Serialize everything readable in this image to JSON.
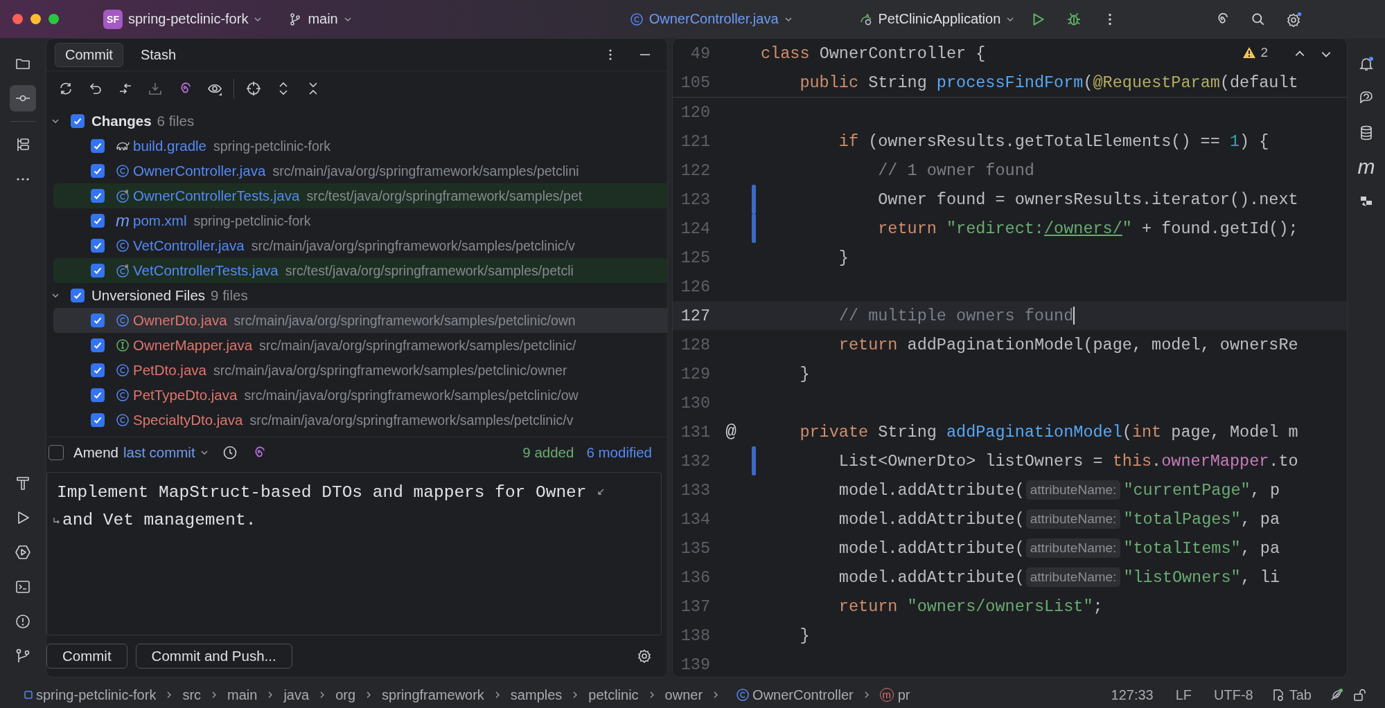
{
  "title_bar": {
    "project_badge": "SF",
    "project": "spring-petclinic-fork",
    "branch": "main",
    "file": "OwnerController.java",
    "run_config": "PetClinicApplication"
  },
  "commit_panel": {
    "tabs": [
      {
        "label": "Commit",
        "selected": true
      },
      {
        "label": "Stash",
        "selected": false
      }
    ],
    "groups": [
      {
        "label": "Changes",
        "count": "6 files",
        "checked": true,
        "expanded": true,
        "bold": true,
        "files": [
          {
            "name": "build.gradle",
            "path": "spring-petclinic-fork",
            "kind": "gradle",
            "color": "#548af7",
            "checked": true,
            "selected": false,
            "highlighted": false
          },
          {
            "name": "OwnerController.java",
            "path": "src/main/java/org/springframework/samples/petclini",
            "kind": "class",
            "color": "#548af7",
            "checked": true,
            "selected": false,
            "highlighted": false
          },
          {
            "name": "OwnerControllerTests.java",
            "path": "src/test/java/org/springframework/samples/pet",
            "kind": "test-class",
            "color": "#548af7",
            "checked": true,
            "selected": false,
            "highlighted": true
          },
          {
            "name": "pom.xml",
            "path": "spring-petclinic-fork",
            "kind": "maven",
            "glyph": "m",
            "color": "#548af7",
            "checked": true,
            "selected": false,
            "highlighted": false
          },
          {
            "name": "VetController.java",
            "path": "src/main/java/org/springframework/samples/petclinic/v",
            "kind": "class",
            "color": "#548af7",
            "checked": true,
            "selected": false,
            "highlighted": false
          },
          {
            "name": "VetControllerTests.java",
            "path": "src/test/java/org/springframework/samples/petcli",
            "kind": "test-class",
            "color": "#548af7",
            "checked": true,
            "selected": false,
            "highlighted": true
          }
        ]
      },
      {
        "label": "Unversioned Files",
        "count": "9 files",
        "checked": true,
        "expanded": true,
        "bold": false,
        "files": [
          {
            "name": "OwnerDto.java",
            "path": "src/main/java/org/springframework/samples/petclinic/own",
            "kind": "class",
            "color": "#e0756e",
            "checked": true,
            "selected": true,
            "highlighted": false
          },
          {
            "name": "OwnerMapper.java",
            "path": "src/main/java/org/springframework/samples/petclinic/",
            "kind": "interface",
            "color": "#e0756e",
            "checked": true,
            "selected": false,
            "highlighted": false
          },
          {
            "name": "PetDto.java",
            "path": "src/main/java/org/springframework/samples/petclinic/owner",
            "kind": "class",
            "color": "#e0756e",
            "checked": true,
            "selected": false,
            "highlighted": false
          },
          {
            "name": "PetTypeDto.java",
            "path": "src/main/java/org/springframework/samples/petclinic/ow",
            "kind": "class",
            "color": "#e0756e",
            "checked": true,
            "selected": false,
            "highlighted": false
          },
          {
            "name": "SpecialtyDto.java",
            "path": "src/main/java/org/springframework/samples/petclinic/v",
            "kind": "class",
            "color": "#e0756e",
            "checked": true,
            "selected": false,
            "highlighted": false
          }
        ]
      }
    ],
    "amend": {
      "checked": false,
      "label": "Amend",
      "link": "last commit"
    },
    "summary": [
      {
        "text": "9 added",
        "color": "#6aab73"
      },
      {
        "text": "6 modified",
        "color": "#548af7"
      }
    ],
    "message_lines": [
      "Implement MapStruct-based DTOs and mappers for Owner",
      "and Vet management."
    ],
    "buttons": [
      "Commit",
      "Commit and Push..."
    ]
  },
  "editor": {
    "warnings": "2",
    "sticky_lines": [
      {
        "number": "49",
        "tokens": [
          {
            "kind": "keyword",
            "text": "class "
          },
          {
            "kind": "plain",
            "text": "OwnerController {"
          }
        ]
      },
      {
        "number": "105",
        "tokens": [
          {
            "kind": "keyword",
            "text": "    public "
          },
          {
            "kind": "plain",
            "text": "String "
          },
          {
            "kind": "method",
            "text": "processFindForm"
          },
          {
            "kind": "plain",
            "text": "("
          },
          {
            "kind": "annotation",
            "text": "@RequestParam"
          },
          {
            "kind": "plain",
            "text": "(default"
          }
        ]
      }
    ],
    "lines": [
      {
        "number": "120",
        "current": false,
        "changed": false
      },
      {
        "number": "121",
        "current": false,
        "changed": false,
        "tokens": [
          {
            "kind": "keyword",
            "text": "        if "
          },
          {
            "kind": "plain",
            "text": "(ownersResults.getTotalElements() == "
          },
          {
            "kind": "number",
            "text": "1"
          },
          {
            "kind": "plain",
            "text": ") {"
          }
        ]
      },
      {
        "number": "122",
        "current": false,
        "changed": false,
        "tokens": [
          {
            "kind": "comment",
            "text": "            // 1 owner found"
          }
        ]
      },
      {
        "number": "123",
        "current": false,
        "changed": true,
        "tokens": [
          {
            "kind": "plain",
            "text": "            Owner found = ownersResults.iterator().next"
          }
        ]
      },
      {
        "number": "124",
        "current": false,
        "changed": true,
        "tokens": [
          {
            "kind": "keyword",
            "text": "            return "
          },
          {
            "kind": "string",
            "text": "\"redirect:"
          },
          {
            "kind": "url",
            "text": "/owners/"
          },
          {
            "kind": "string",
            "text": "\""
          },
          {
            "kind": "plain",
            "text": " + found.getId();"
          }
        ]
      },
      {
        "number": "125",
        "current": false,
        "changed": false,
        "tokens": [
          {
            "kind": "plain",
            "text": "        }"
          }
        ]
      },
      {
        "number": "126",
        "current": false,
        "changed": false
      },
      {
        "number": "127",
        "current": true,
        "changed": false,
        "tokens": [
          {
            "kind": "comment",
            "text": "        // multiple owners found"
          }
        ]
      },
      {
        "number": "128",
        "current": false,
        "changed": false,
        "tokens": [
          {
            "kind": "keyword",
            "text": "        return "
          },
          {
            "kind": "plain",
            "text": "addPaginationModel(page, model, ownersRe"
          }
        ]
      },
      {
        "number": "129",
        "current": false,
        "changed": false,
        "tokens": [
          {
            "kind": "plain",
            "text": "    }"
          }
        ]
      },
      {
        "number": "130",
        "current": false,
        "changed": false
      },
      {
        "number": "131",
        "current": false,
        "changed": false,
        "gutter_mark": "@",
        "tokens": [
          {
            "kind": "keyword",
            "text": "    private "
          },
          {
            "kind": "plain",
            "text": "String "
          },
          {
            "kind": "method",
            "text": "addPaginationModel"
          },
          {
            "kind": "plain",
            "text": "("
          },
          {
            "kind": "keyword",
            "text": "int "
          },
          {
            "kind": "plain",
            "text": "page, Model m"
          }
        ]
      },
      {
        "number": "132",
        "current": false,
        "changed": true,
        "tokens": [
          {
            "kind": "plain",
            "text": "        List<OwnerDto> listOwners = "
          },
          {
            "kind": "keyword",
            "text": "this"
          },
          {
            "kind": "plain",
            "text": "."
          },
          {
            "kind": "field",
            "text": "ownerMapper"
          },
          {
            "kind": "plain",
            "text": ".to"
          }
        ]
      },
      {
        "number": "133",
        "current": false,
        "changed": false,
        "tokens": [
          {
            "kind": "plain",
            "text": "        model.addAttribute("
          },
          {
            "kind": "hint",
            "text": "attributeName:"
          },
          {
            "kind": "string",
            "text": "\"currentPage\""
          },
          {
            "kind": "plain",
            "text": ", p"
          }
        ]
      },
      {
        "number": "134",
        "current": false,
        "changed": false,
        "tokens": [
          {
            "kind": "plain",
            "text": "        model.addAttribute("
          },
          {
            "kind": "hint",
            "text": "attributeName:"
          },
          {
            "kind": "string",
            "text": "\"totalPages\""
          },
          {
            "kind": "plain",
            "text": ", pa"
          }
        ]
      },
      {
        "number": "135",
        "current": false,
        "changed": false,
        "tokens": [
          {
            "kind": "plain",
            "text": "        model.addAttribute("
          },
          {
            "kind": "hint",
            "text": "attributeName:"
          },
          {
            "kind": "string",
            "text": "\"totalItems\""
          },
          {
            "kind": "plain",
            "text": ", pa"
          }
        ]
      },
      {
        "number": "136",
        "current": false,
        "changed": false,
        "tokens": [
          {
            "kind": "plain",
            "text": "        model.addAttribute("
          },
          {
            "kind": "hint",
            "text": "attributeName:"
          },
          {
            "kind": "string",
            "text": "\"listOwners\""
          },
          {
            "kind": "plain",
            "text": ", li"
          }
        ]
      },
      {
        "number": "137",
        "current": false,
        "changed": false,
        "tokens": [
          {
            "kind": "keyword",
            "text": "        return "
          },
          {
            "kind": "string",
            "text": "\"owners/ownersList\""
          },
          {
            "kind": "plain",
            "text": ";"
          }
        ]
      },
      {
        "number": "138",
        "current": false,
        "changed": false,
        "tokens": [
          {
            "kind": "plain",
            "text": "    }"
          }
        ]
      },
      {
        "number": "139",
        "current": false,
        "changed": false
      }
    ]
  },
  "right_strip": {
    "maven_glyph": "m"
  },
  "status_bar": {
    "breadcrumbs": [
      {
        "kind": "project",
        "text": "spring-petclinic-fork"
      },
      {
        "kind": "folder",
        "text": "src"
      },
      {
        "kind": "folder",
        "text": "main"
      },
      {
        "kind": "folder",
        "text": "java"
      },
      {
        "kind": "folder",
        "text": "org"
      },
      {
        "kind": "folder",
        "text": "springframework"
      },
      {
        "kind": "folder",
        "text": "samples"
      },
      {
        "kind": "folder",
        "text": "petclinic"
      },
      {
        "kind": "folder",
        "text": "owner"
      },
      {
        "kind": "class",
        "text": "OwnerController"
      },
      {
        "kind": "method",
        "glyph": "m",
        "text": "pr"
      }
    ],
    "position": "127:33",
    "line_separator": "LF",
    "encoding": "UTF-8",
    "indent": "Tab"
  }
}
